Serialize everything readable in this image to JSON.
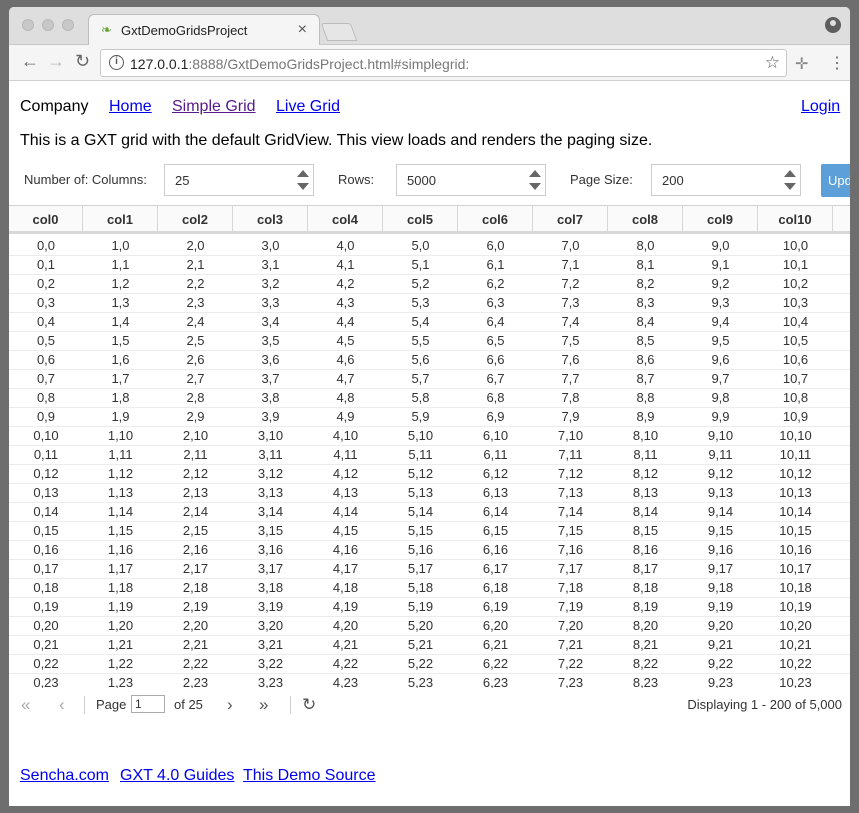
{
  "browser": {
    "tab_title": "GxtDemoGridsProject",
    "url_host": "127.0.0.1",
    "url_rest": ":8888/GxtDemoGridsProject.html#simplegrid:"
  },
  "nav": {
    "company": "Company",
    "links": [
      "Home",
      "Simple Grid",
      "Live Grid"
    ],
    "login": "Login"
  },
  "description": "This is a GXT grid with the default GridView. This view loads and renders the paging size.",
  "controls": {
    "columns_label": "Number of: Columns:",
    "columns_value": "25",
    "rows_label": "Rows:",
    "rows_value": "5000",
    "page_size_label": "Page Size:",
    "page_size_value": "200",
    "update_label": "Upd"
  },
  "grid": {
    "columns": [
      "col0",
      "col1",
      "col2",
      "col3",
      "col4",
      "col5",
      "col6",
      "col7",
      "col8",
      "col9",
      "col10",
      ""
    ],
    "rows": [
      [
        "0,0",
        "1,0",
        "2,0",
        "3,0",
        "4,0",
        "5,0",
        "6,0",
        "7,0",
        "8,0",
        "9,0",
        "10,0"
      ],
      [
        "0,1",
        "1,1",
        "2,1",
        "3,1",
        "4,1",
        "5,1",
        "6,1",
        "7,1",
        "8,1",
        "9,1",
        "10,1"
      ],
      [
        "0,2",
        "1,2",
        "2,2",
        "3,2",
        "4,2",
        "5,2",
        "6,2",
        "7,2",
        "8,2",
        "9,2",
        "10,2"
      ],
      [
        "0,3",
        "1,3",
        "2,3",
        "3,3",
        "4,3",
        "5,3",
        "6,3",
        "7,3",
        "8,3",
        "9,3",
        "10,3"
      ],
      [
        "0,4",
        "1,4",
        "2,4",
        "3,4",
        "4,4",
        "5,4",
        "6,4",
        "7,4",
        "8,4",
        "9,4",
        "10,4"
      ],
      [
        "0,5",
        "1,5",
        "2,5",
        "3,5",
        "4,5",
        "5,5",
        "6,5",
        "7,5",
        "8,5",
        "9,5",
        "10,5"
      ],
      [
        "0,6",
        "1,6",
        "2,6",
        "3,6",
        "4,6",
        "5,6",
        "6,6",
        "7,6",
        "8,6",
        "9,6",
        "10,6"
      ],
      [
        "0,7",
        "1,7",
        "2,7",
        "3,7",
        "4,7",
        "5,7",
        "6,7",
        "7,7",
        "8,7",
        "9,7",
        "10,7"
      ],
      [
        "0,8",
        "1,8",
        "2,8",
        "3,8",
        "4,8",
        "5,8",
        "6,8",
        "7,8",
        "8,8",
        "9,8",
        "10,8"
      ],
      [
        "0,9",
        "1,9",
        "2,9",
        "3,9",
        "4,9",
        "5,9",
        "6,9",
        "7,9",
        "8,9",
        "9,9",
        "10,9"
      ],
      [
        "0,10",
        "1,10",
        "2,10",
        "3,10",
        "4,10",
        "5,10",
        "6,10",
        "7,10",
        "8,10",
        "9,10",
        "10,10"
      ],
      [
        "0,11",
        "1,11",
        "2,11",
        "3,11",
        "4,11",
        "5,11",
        "6,11",
        "7,11",
        "8,11",
        "9,11",
        "10,11"
      ],
      [
        "0,12",
        "1,12",
        "2,12",
        "3,12",
        "4,12",
        "5,12",
        "6,12",
        "7,12",
        "8,12",
        "9,12",
        "10,12"
      ],
      [
        "0,13",
        "1,13",
        "2,13",
        "3,13",
        "4,13",
        "5,13",
        "6,13",
        "7,13",
        "8,13",
        "9,13",
        "10,13"
      ],
      [
        "0,14",
        "1,14",
        "2,14",
        "3,14",
        "4,14",
        "5,14",
        "6,14",
        "7,14",
        "8,14",
        "9,14",
        "10,14"
      ],
      [
        "0,15",
        "1,15",
        "2,15",
        "3,15",
        "4,15",
        "5,15",
        "6,15",
        "7,15",
        "8,15",
        "9,15",
        "10,15"
      ],
      [
        "0,16",
        "1,16",
        "2,16",
        "3,16",
        "4,16",
        "5,16",
        "6,16",
        "7,16",
        "8,16",
        "9,16",
        "10,16"
      ],
      [
        "0,17",
        "1,17",
        "2,17",
        "3,17",
        "4,17",
        "5,17",
        "6,17",
        "7,17",
        "8,17",
        "9,17",
        "10,17"
      ],
      [
        "0,18",
        "1,18",
        "2,18",
        "3,18",
        "4,18",
        "5,18",
        "6,18",
        "7,18",
        "8,18",
        "9,18",
        "10,18"
      ],
      [
        "0,19",
        "1,19",
        "2,19",
        "3,19",
        "4,19",
        "5,19",
        "6,19",
        "7,19",
        "8,19",
        "9,19",
        "10,19"
      ],
      [
        "0,20",
        "1,20",
        "2,20",
        "3,20",
        "4,20",
        "5,20",
        "6,20",
        "7,20",
        "8,20",
        "9,20",
        "10,20"
      ],
      [
        "0,21",
        "1,21",
        "2,21",
        "3,21",
        "4,21",
        "5,21",
        "6,21",
        "7,21",
        "8,21",
        "9,21",
        "10,21"
      ],
      [
        "0,22",
        "1,22",
        "2,22",
        "3,22",
        "4,22",
        "5,22",
        "6,22",
        "7,22",
        "8,22",
        "9,22",
        "10,22"
      ],
      [
        "0,23",
        "1,23",
        "2,23",
        "3,23",
        "4,23",
        "5,23",
        "6,23",
        "7,23",
        "8,23",
        "9,23",
        "10,23"
      ]
    ]
  },
  "pager": {
    "page_label": "Page",
    "page_value": "1",
    "of_label": "of 25",
    "display_text": "Displaying 1 - 200 of 5,000"
  },
  "footer": {
    "links": [
      "Sencha.com",
      "GXT 4.0 Guides",
      "This Demo Source"
    ]
  },
  "colors": {
    "link": "#0000ee",
    "visited_link": "#551a8b",
    "update_button": "#5d9fd8"
  }
}
